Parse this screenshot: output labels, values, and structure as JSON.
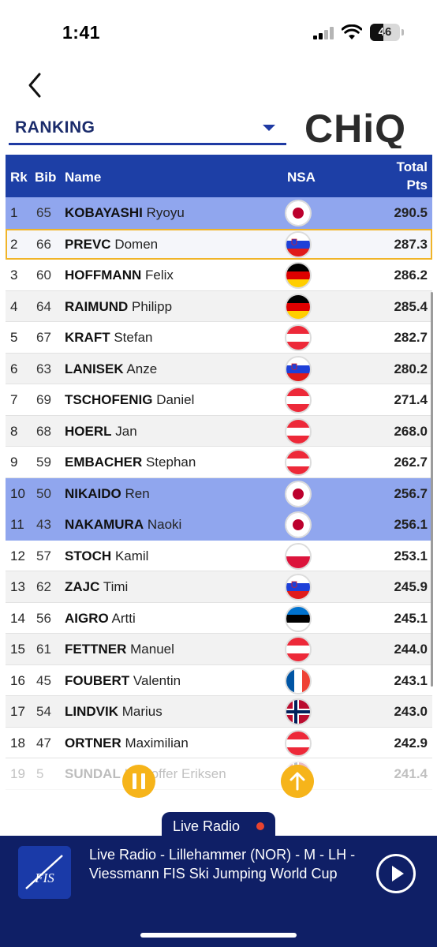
{
  "status_bar": {
    "time": "1:41",
    "battery": "46",
    "battery_level": 0.46
  },
  "header": {
    "dropdown_label": "RANKING",
    "logo_text": "CHiQ"
  },
  "table": {
    "headers": {
      "rk": "Rk",
      "bib": "Bib",
      "name": "Name",
      "nsa": "NSA",
      "total": "Total",
      "pts": "Pts"
    },
    "rows": [
      {
        "rk": "1",
        "bib": "65",
        "surname": "KOBAYASHI",
        "firstname": "Ryoyu",
        "nsa": "JPN",
        "pts": "290.5",
        "style": "hl-blue"
      },
      {
        "rk": "2",
        "bib": "66",
        "surname": "PREVC",
        "firstname": "Domen",
        "nsa": "SLO",
        "pts": "287.3",
        "style": "hl-gold"
      },
      {
        "rk": "3",
        "bib": "60",
        "surname": "HOFFMANN",
        "firstname": "Felix",
        "nsa": "GER",
        "pts": "286.2",
        "style": ""
      },
      {
        "rk": "4",
        "bib": "64",
        "surname": "RAIMUND",
        "firstname": "Philipp",
        "nsa": "GER",
        "pts": "285.4",
        "style": "alt"
      },
      {
        "rk": "5",
        "bib": "67",
        "surname": "KRAFT",
        "firstname": "Stefan",
        "nsa": "AUT",
        "pts": "282.7",
        "style": ""
      },
      {
        "rk": "6",
        "bib": "63",
        "surname": "LANISEK",
        "firstname": "Anze",
        "nsa": "SLO",
        "pts": "280.2",
        "style": "alt"
      },
      {
        "rk": "7",
        "bib": "69",
        "surname": "TSCHOFENIG",
        "firstname": "Daniel",
        "nsa": "AUT",
        "pts": "271.4",
        "style": ""
      },
      {
        "rk": "8",
        "bib": "68",
        "surname": "HOERL",
        "firstname": "Jan",
        "nsa": "AUT",
        "pts": "268.0",
        "style": "alt"
      },
      {
        "rk": "9",
        "bib": "59",
        "surname": "EMBACHER",
        "firstname": "Stephan",
        "nsa": "AUT",
        "pts": "262.7",
        "style": ""
      },
      {
        "rk": "10",
        "bib": "50",
        "surname": "NIKAIDO",
        "firstname": "Ren",
        "nsa": "JPN",
        "pts": "256.7",
        "style": "hl-blue"
      },
      {
        "rk": "11",
        "bib": "43",
        "surname": "NAKAMURA",
        "firstname": "Naoki",
        "nsa": "JPN",
        "pts": "256.1",
        "style": "hl-blue"
      },
      {
        "rk": "12",
        "bib": "57",
        "surname": "STOCH",
        "firstname": "Kamil",
        "nsa": "POL",
        "pts": "253.1",
        "style": ""
      },
      {
        "rk": "13",
        "bib": "62",
        "surname": "ZAJC",
        "firstname": "Timi",
        "nsa": "SLO",
        "pts": "245.9",
        "style": "alt"
      },
      {
        "rk": "14",
        "bib": "56",
        "surname": "AIGRO",
        "firstname": "Artti",
        "nsa": "EST",
        "pts": "245.1",
        "style": ""
      },
      {
        "rk": "15",
        "bib": "61",
        "surname": "FETTNER",
        "firstname": "Manuel",
        "nsa": "AUT",
        "pts": "244.0",
        "style": "alt"
      },
      {
        "rk": "16",
        "bib": "45",
        "surname": "FOUBERT",
        "firstname": "Valentin",
        "nsa": "FRA",
        "pts": "243.1",
        "style": ""
      },
      {
        "rk": "17",
        "bib": "54",
        "surname": "LINDVIK",
        "firstname": "Marius",
        "nsa": "NOR",
        "pts": "243.0",
        "style": "alt"
      },
      {
        "rk": "18",
        "bib": "47",
        "surname": "ORTNER",
        "firstname": "Maximilian",
        "nsa": "AUT",
        "pts": "242.9",
        "style": ""
      },
      {
        "rk": "19",
        "bib": "5",
        "surname": "SUNDAL",
        "firstname": "Kristoffer Eriksen",
        "nsa": "NOR",
        "pts": "241.4",
        "style": "fade"
      }
    ]
  },
  "radio": {
    "tab_label": "Live Radio",
    "title": "Live Radio - Lillehammer (NOR) - M - LH - Viessmann FIS Ski Jumping World Cup",
    "logo_text": "FIS"
  },
  "colors": {
    "header_blue": "#1d3fa6",
    "highlight_blue": "#90a6ee",
    "highlight_gold": "#f0b429",
    "radio_navy": "#0f1f66",
    "accent_orange": "#f6b41a"
  }
}
